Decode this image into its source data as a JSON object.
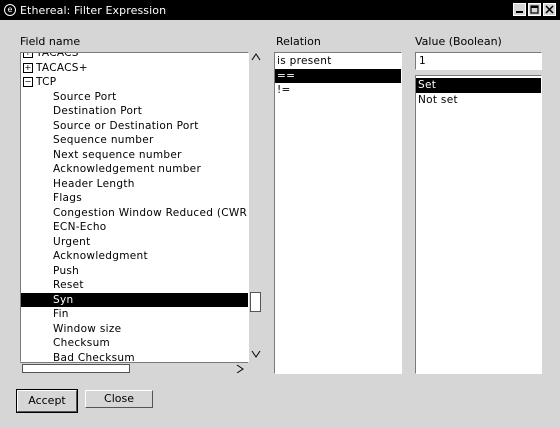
{
  "window": {
    "title": "Ethereal: Filter Expression",
    "controls": [
      "minimize",
      "maximize",
      "close"
    ]
  },
  "field_name": {
    "label": "Field name",
    "items": [
      {
        "text": "TACACS",
        "level": 0,
        "expander": "+"
      },
      {
        "text": "TACACS+",
        "level": 0,
        "expander": "+"
      },
      {
        "text": "TCP",
        "level": 0,
        "expander": "−"
      },
      {
        "text": "Source Port",
        "level": 1
      },
      {
        "text": "Destination Port",
        "level": 1
      },
      {
        "text": "Source or Destination Port",
        "level": 1
      },
      {
        "text": "Sequence number",
        "level": 1
      },
      {
        "text": "Next sequence number",
        "level": 1
      },
      {
        "text": "Acknowledgement number",
        "level": 1
      },
      {
        "text": "Header Length",
        "level": 1
      },
      {
        "text": "Flags",
        "level": 1
      },
      {
        "text": "Congestion Window Reduced (CWR)",
        "level": 1
      },
      {
        "text": "ECN-Echo",
        "level": 1
      },
      {
        "text": "Urgent",
        "level": 1
      },
      {
        "text": "Acknowledgment",
        "level": 1
      },
      {
        "text": "Push",
        "level": 1
      },
      {
        "text": "Reset",
        "level": 1
      },
      {
        "text": "Syn",
        "level": 1,
        "selected": true
      },
      {
        "text": "Fin",
        "level": 1
      },
      {
        "text": "Window size",
        "level": 1
      },
      {
        "text": "Checksum",
        "level": 1
      },
      {
        "text": "Bad Checksum",
        "level": 1
      }
    ]
  },
  "relation": {
    "label": "Relation",
    "items": [
      {
        "text": "is present"
      },
      {
        "text": "==",
        "selected": true
      },
      {
        "text": "!="
      }
    ]
  },
  "value": {
    "label": "Value (Boolean)",
    "input_value": "1",
    "items": [
      {
        "text": "Set",
        "selected": true
      },
      {
        "text": "Not set"
      }
    ]
  },
  "buttons": {
    "accept": "Accept",
    "close": "Close"
  },
  "colors": {
    "dialog_bg": "#d6d6d6",
    "title_bar": "#000000",
    "selection": "#000000"
  }
}
